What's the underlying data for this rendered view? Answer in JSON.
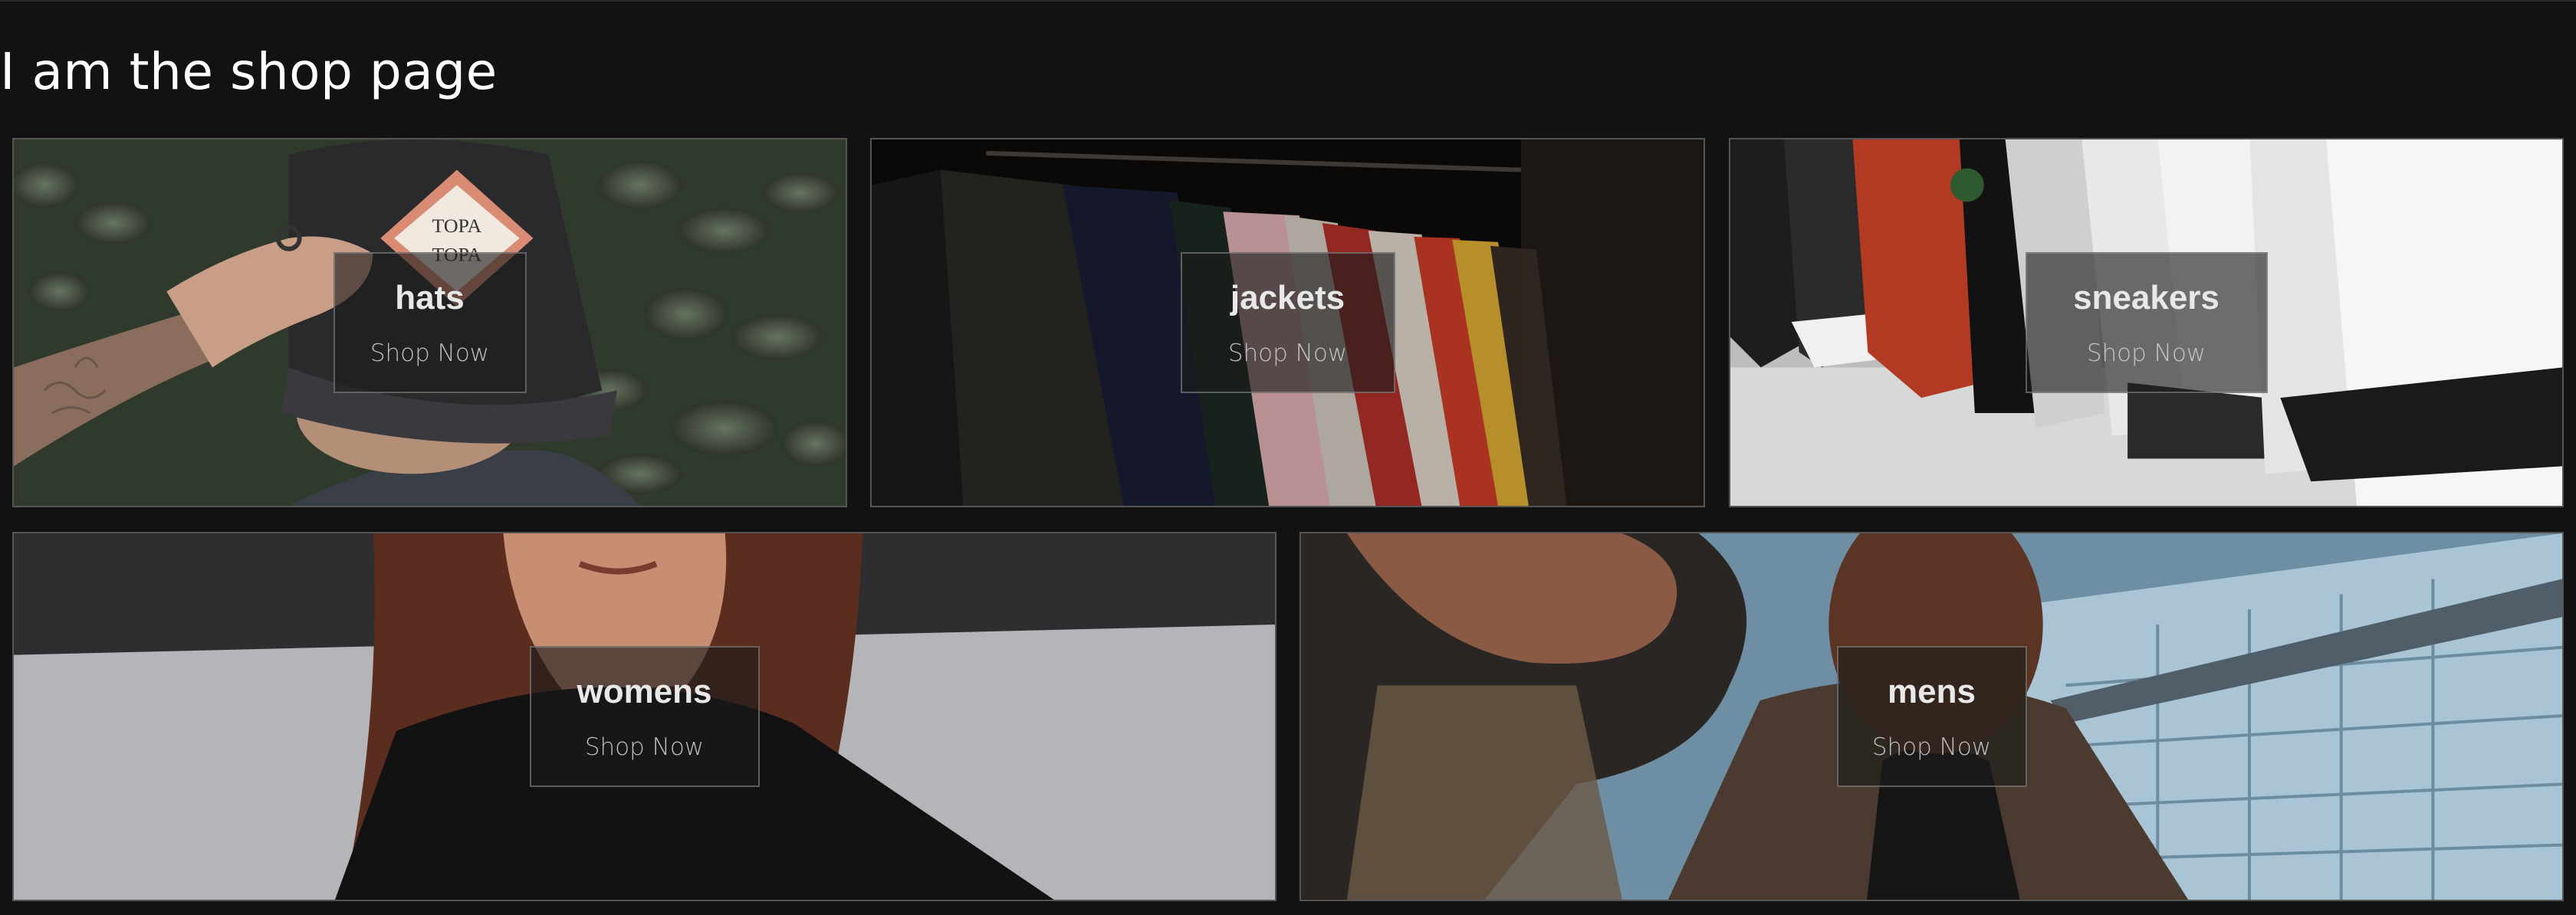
{
  "page": {
    "title": "I am the shop page"
  },
  "directory": {
    "categories": [
      {
        "id": "hats",
        "title": "hats",
        "cta": "Shop Now"
      },
      {
        "id": "jackets",
        "title": "jackets",
        "cta": "Shop Now"
      },
      {
        "id": "sneakers",
        "title": "sneakers",
        "cta": "Shop Now"
      },
      {
        "id": "womens",
        "title": "womens",
        "cta": "Shop Now"
      },
      {
        "id": "mens",
        "title": "mens",
        "cta": "Shop Now"
      }
    ]
  },
  "images": {
    "hats": {
      "logo_line1": "TOPA",
      "logo_line2": "TOPA"
    }
  },
  "colors": {
    "background": "#121212",
    "title": "#ffffff",
    "overlay": "#1c1c1c"
  }
}
